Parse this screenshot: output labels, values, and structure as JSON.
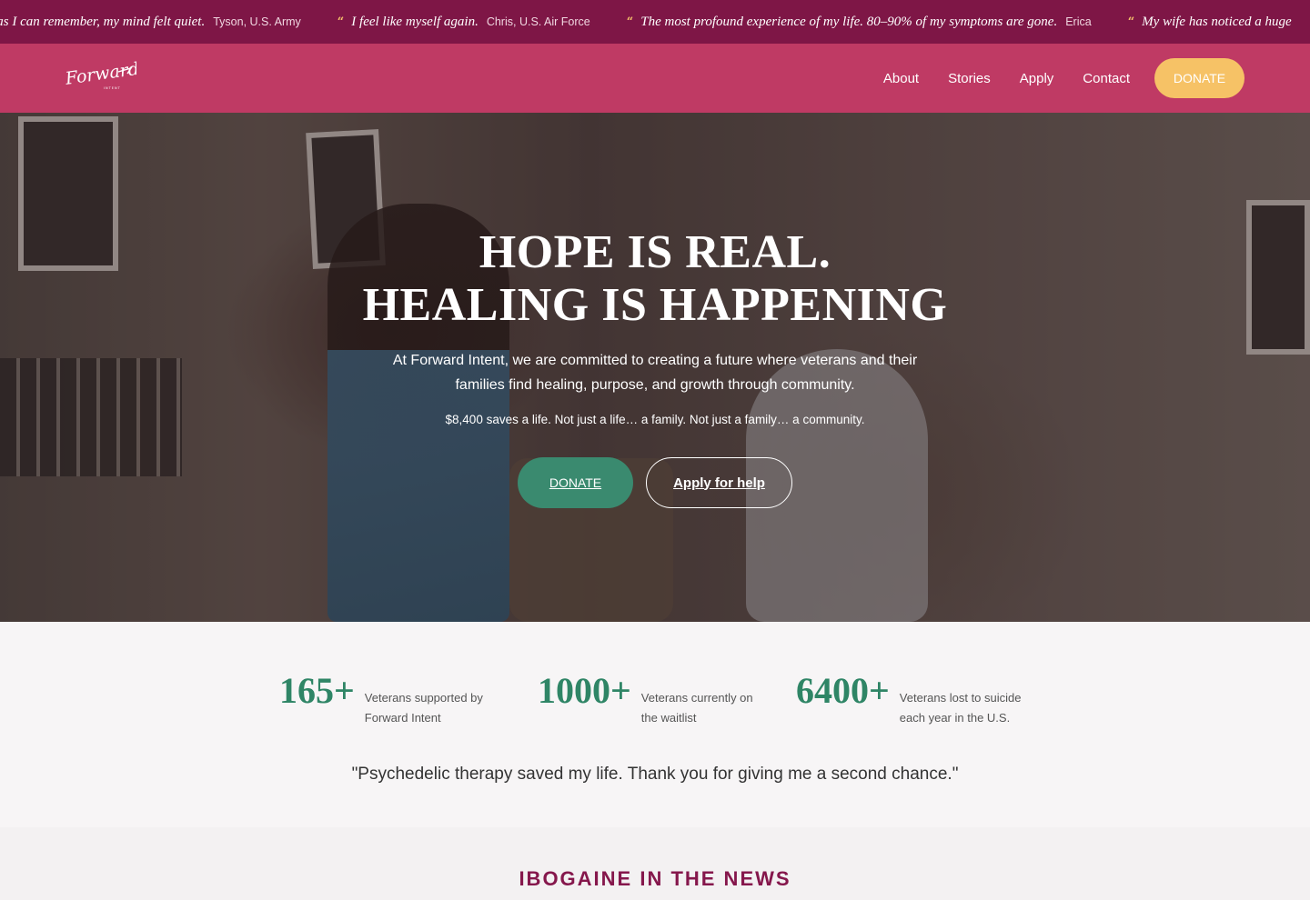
{
  "ticker": [
    {
      "quote": "ong as I can remember, my mind felt quiet.",
      "author": "Tyson, U.S. Army"
    },
    {
      "quote": "I feel like myself again.",
      "author": "Chris, U.S. Air Force"
    },
    {
      "quote": "The most profound experience of my life. 80–90% of my symptoms are gone.",
      "author": "Erica"
    },
    {
      "quote": "My wife has noticed a huge",
      "author": ""
    }
  ],
  "ticker_quote_mark": "“",
  "logo": {
    "text": "Forward",
    "sub": "INTENT"
  },
  "nav": {
    "about": "About",
    "stories": "Stories",
    "apply": "Apply",
    "contact": "Contact",
    "donate": "DONATE"
  },
  "hero": {
    "title_line1": "HOPE IS REAL.",
    "title_line2": "HEALING IS HAPPENING",
    "subtitle": "At Forward Intent, we are committed to creating a future where veterans and their families find healing, purpose, and growth through community.",
    "note": "$8,400 saves a life. Not just a life… a family. Not just a family… a community.",
    "donate_label": "DONATE",
    "apply_label": "Apply for help"
  },
  "stats": [
    {
      "number": "165+",
      "label": "Veterans supported by Forward Intent"
    },
    {
      "number": "1000+",
      "label": "Veterans currently on the waitlist"
    },
    {
      "number": "6400+",
      "label": "Veterans lost to suicide each year in the U.S."
    }
  ],
  "testimonial": "\"Psychedelic therapy saved my life. Thank you for giving me a second chance.\"",
  "news": {
    "title": "IBOGAINE IN THE NEWS"
  },
  "colors": {
    "ticker_bg": "#7e1646",
    "header_bg": "#bf3a64",
    "donate_yellow": "#f6c266",
    "donate_green": "#3a8a6f",
    "stat_green": "#2f8566",
    "news_title": "#85174c"
  }
}
